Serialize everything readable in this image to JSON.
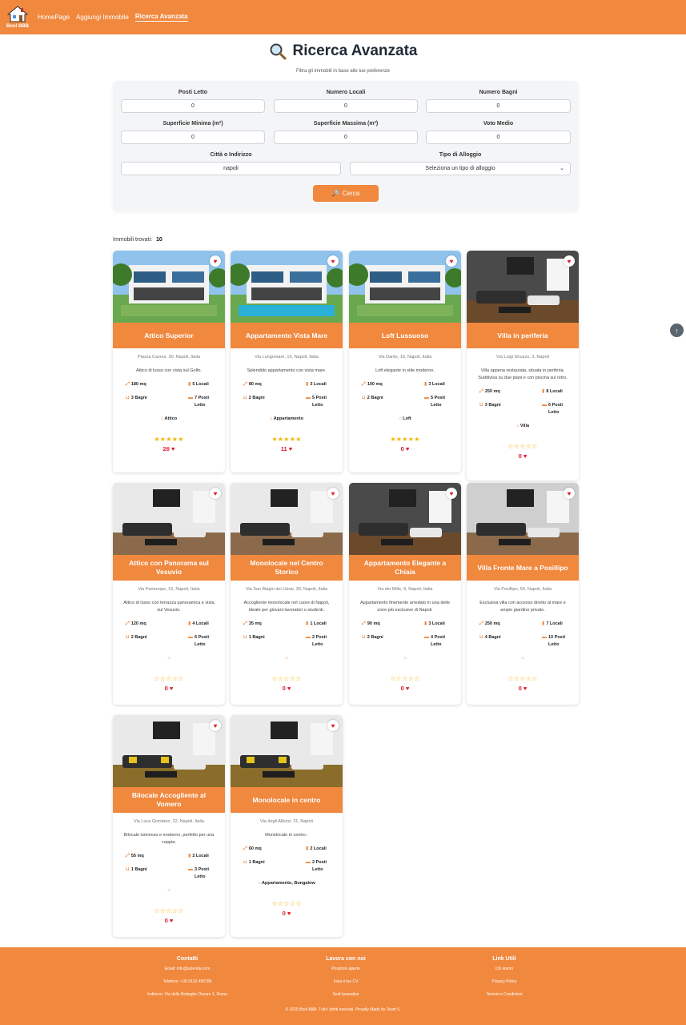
{
  "brand": {
    "logo_text": "Bool BBB"
  },
  "nav": {
    "links": [
      "HomePage",
      "Aggiungi Immobile",
      "Ricerca Avanzata"
    ],
    "active": "Ricerca Avanzata"
  },
  "page": {
    "title": "Ricerca Avanzata",
    "subtitle": "Filtra gli immobili in base alle tue preferenze"
  },
  "search": {
    "posti_letto": {
      "label": "Posti Letto",
      "value": "0"
    },
    "numero_locali": {
      "label": "Numero Locali",
      "value": "0"
    },
    "numero_bagni": {
      "label": "Numero Bagni",
      "value": "0"
    },
    "superficie_min": {
      "label": "Superficie Minima (m²)",
      "value": "0"
    },
    "superficie_max": {
      "label": "Superficie Massima (m²)",
      "value": "0"
    },
    "voto_medio": {
      "label": "Voto Medio",
      "value": "0"
    },
    "citta": {
      "label": "Città o Indirizzo",
      "value": "napoli"
    },
    "tipo": {
      "label": "Tipo di Alloggio",
      "value": "Seleziona un tipo di alloggio"
    },
    "button": "Cerca"
  },
  "results": {
    "label": "Immobili trovati:",
    "count": "10"
  },
  "accent_color": "#f0883e",
  "cards": [
    {
      "title": "Attico Superior",
      "address": "Piazza Cavour, 30, Napoli, Italia",
      "description": "Attico di lusso con vista sul Golfo.",
      "mq": "180 mq",
      "locali": "5 Locali",
      "bagni": "3 Bagni",
      "posti": "7 Posti Letto",
      "type": "Attico",
      "stars": "★★★★★",
      "likes": "26",
      "photo": "modern-villa-pool"
    },
    {
      "title": "Appartamento Vista Mare",
      "address": "Via Lungomare, 10, Napoli, Italia",
      "description": "Splendido appartamento con vista mare.",
      "mq": "80 mq",
      "locali": "3 Locali",
      "bagni": "2 Bagni",
      "posti": "5 Posti Letto",
      "type": "Appartamento",
      "stars": "★★★★★",
      "likes": "11",
      "photo": "villa-pool-deck"
    },
    {
      "title": "Loft Lussuoso",
      "address": "Via Dante, 10, Napoli, Italia",
      "description": "Loft elegante in stile moderno.",
      "mq": "100 mq",
      "locali": "3 Locali",
      "bagni": "2 Bagni",
      "posti": "5 Posti Letto",
      "type": "Loft",
      "stars": "★★★★★",
      "likes": "0",
      "photo": "modern-villa-pool"
    },
    {
      "title": "Villa in periferia",
      "address": "Via Luigi Struzzo, 3, Napoli",
      "description": "Villa appena restaurata, situata in periferia. Suddivisa su due piani e con piscina sul retro.",
      "mq": "250 mq",
      "locali": "8 Locali",
      "bagni": "3 Bagni",
      "posti": "6 Posti Letto",
      "type": "Villa",
      "stars": "☆☆☆☆☆",
      "likes": "0",
      "photo": "living-room-dark"
    },
    {
      "title": "Attico con Panorama sul Vesuvio",
      "address": "Via Partenope, 15, Napoli, Italia",
      "description": "Attico di lusso con terrazza panoramica e vista sul Vesuvio.",
      "mq": "120 mq",
      "locali": "4 Locali",
      "bagni": "2 Bagni",
      "posti": "6 Posti Letto",
      "type": "",
      "stars": "☆☆☆☆☆",
      "likes": "0",
      "photo": "living-room-white"
    },
    {
      "title": "Monolocale nel Centro Storico",
      "address": "Via San Biagio dei Librai, 30, Napoli, Italia",
      "description": "Accogliente monolocale nel cuore di Napoli, ideale per giovani lavoratori o studenti.",
      "mq": "35 mq",
      "locali": "1 Locali",
      "bagni": "1 Bagni",
      "posti": "2 Posti Letto",
      "type": "",
      "stars": "☆☆☆☆☆",
      "likes": "0",
      "photo": "living-room-white"
    },
    {
      "title": "Appartamento Elegante a Chiaia",
      "address": "Via dei Mille, 8, Napoli, Italia",
      "description": "Appartamento finemente arredato in una delle zone più esclusive di Napoli.",
      "mq": "90 mq",
      "locali": "3 Locali",
      "bagni": "2 Bagni",
      "posti": "4 Posti Letto",
      "type": "",
      "stars": "☆☆☆☆☆",
      "likes": "0",
      "photo": "living-room-dark"
    },
    {
      "title": "Villa Fronte Mare a Posillipo",
      "address": "Via Posillipo, 50, Napoli, Italia",
      "description": "Esclusiva villa con accesso diretto al mare e ampio giardino privato.",
      "mq": "250 mq",
      "locali": "7 Locali",
      "bagni": "4 Bagni",
      "posti": "10 Posti Letto",
      "type": "",
      "stars": "☆☆☆☆☆",
      "likes": "0",
      "photo": "living-room-grey"
    },
    {
      "title": "Bilocale Accogliente al Vomero",
      "address": "Via Luca Giordano, 22, Napoli, Italia",
      "description": "Bilocale luminoso e moderno, perfetto per una coppia.",
      "mq": "55 mq",
      "locali": "2 Locali",
      "bagni": "1 Bagni",
      "posti": "3 Posti Letto",
      "type": "",
      "stars": "☆☆☆☆☆",
      "likes": "0",
      "photo": "living-room-yellow"
    },
    {
      "title": "Monolocale in centro",
      "address": "Via degli Albizzi, 31, Napoli",
      "description": "Monolocale in centro :",
      "mq": "60 mq",
      "locali": "2 Locali",
      "bagni": "1 Bagni",
      "posti": "2 Posti Letto",
      "type": "Appartamento, Bungalow",
      "stars": "☆☆☆☆☆",
      "likes": "0",
      "photo": "living-room-yellow"
    }
  ],
  "footer": {
    "contatti": {
      "title": "Contatti",
      "lines": [
        "Email: info@azienda.com",
        "Telefono: +39 0123 456789",
        "Indirizzo: Via delle Botteghe Oscure 1, Roma"
      ]
    },
    "lavora": {
      "title": "Lavora con noi",
      "lines": [
        "Posizioni aperte",
        "Invia il tuo CV",
        "Sedi lavorative"
      ]
    },
    "link": {
      "title": "Link Utili",
      "lines": [
        "Chi siamo",
        "Privacy Policy",
        "Termini e Condizioni"
      ]
    },
    "copyright": "© 2025 Bool B&B. Tutti i diritti riservati. Proudly Made by Team 5."
  }
}
